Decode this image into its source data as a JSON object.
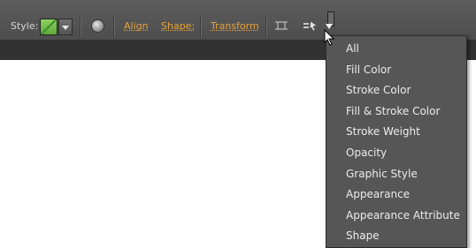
{
  "toolbar": {
    "style_label": "Style:",
    "align_link": "Align",
    "shape_link": "Shape:",
    "transform_link": "Transform"
  },
  "icons": {
    "swatch": "graphic-style-swatch-icon",
    "swatch_dropdown": "chevron-down-icon",
    "recolor": "recolor-globe-icon",
    "isolate": "isolate-selection-icon",
    "select_similar": "select-similar-icon",
    "menu_arrow": "dropdown-arrow-icon",
    "cursor": "mouse-cursor-icon"
  },
  "dropdown": {
    "items": [
      "All",
      "Fill Color",
      "Stroke Color",
      "Fill & Stroke Color",
      "Stroke Weight",
      "Opacity",
      "Graphic Style",
      "Appearance",
      "Appearance Attribute",
      "Shape"
    ]
  },
  "colors": {
    "toolbar_bg": "#555555",
    "menu_bg": "#565656",
    "link_orange": "#e8a23a",
    "menu_text": "#ececec"
  }
}
